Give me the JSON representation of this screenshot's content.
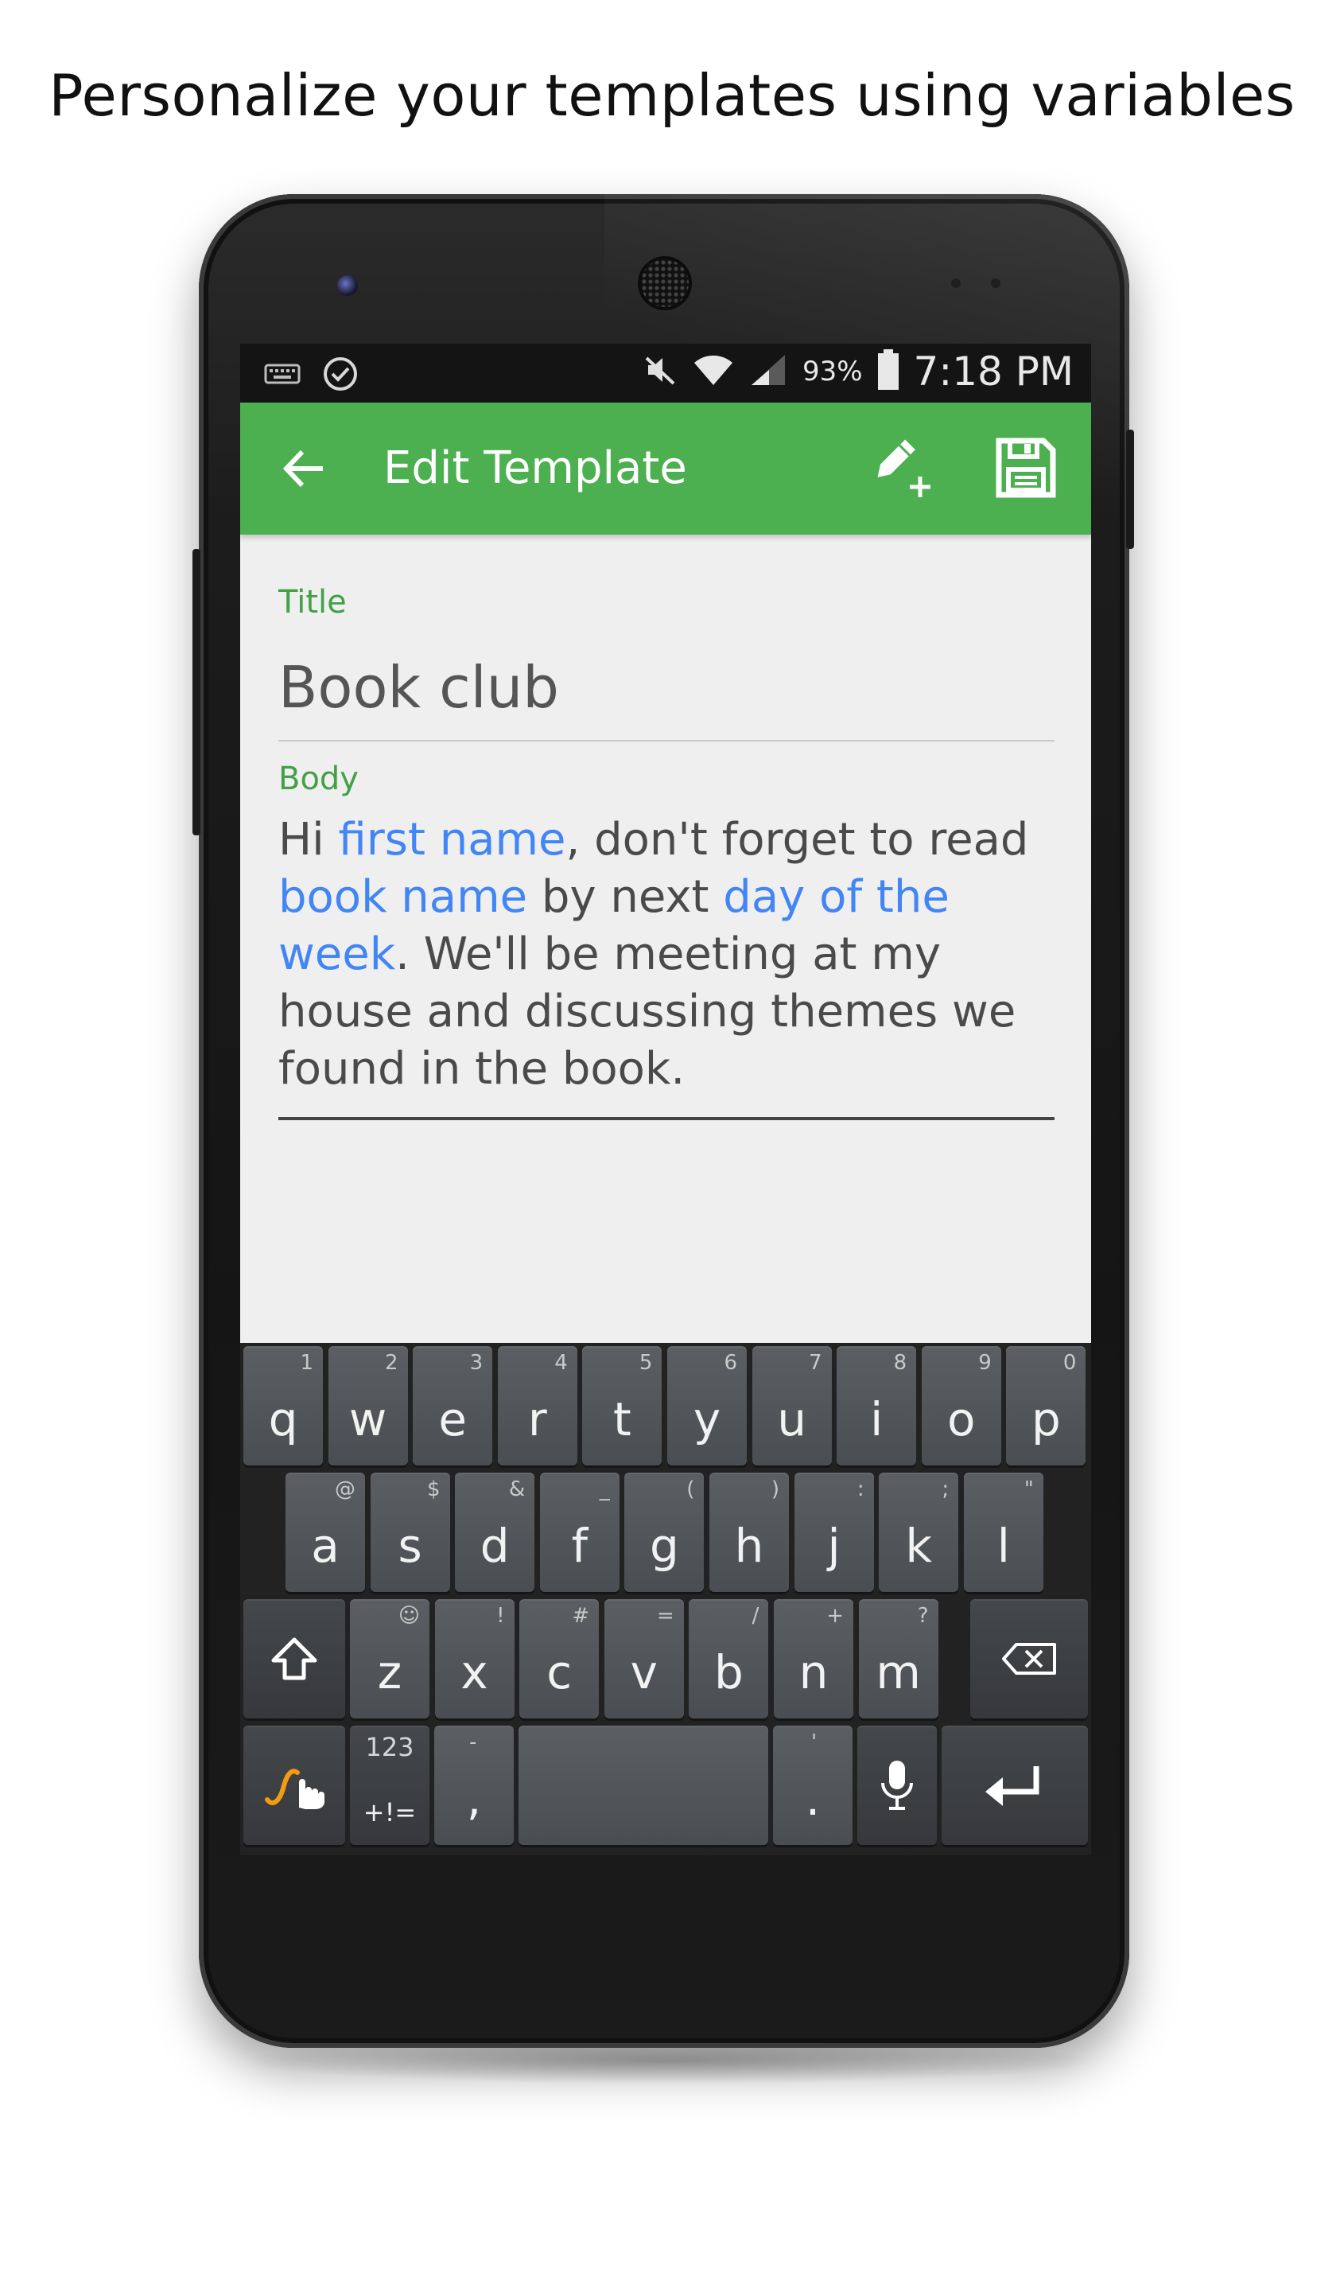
{
  "headline": "Personalize your templates using variables",
  "status_bar": {
    "icons_left": [
      "keyboard-icon",
      "check-circle-icon"
    ],
    "icons_right": [
      "muted-icon",
      "wifi-icon",
      "signal-icon",
      "battery-icon"
    ],
    "battery_percent": "93%",
    "time": "7:18 PM"
  },
  "toolbar": {
    "title": "Edit Template",
    "back_icon": "arrow-back-icon",
    "actions": [
      "insert-variable-icon",
      "save-icon"
    ],
    "color": "#4caf50"
  },
  "form": {
    "title_label": "Title",
    "title_value": "Book club",
    "body_label": "Body",
    "body_parts": [
      {
        "text": "Hi ",
        "var": false
      },
      {
        "text": "first name",
        "var": true
      },
      {
        "text": ", don't forget to read ",
        "var": false
      },
      {
        "text": "book name",
        "var": true
      },
      {
        "text": " by next ",
        "var": false
      },
      {
        "text": "day of the week",
        "var": true
      },
      {
        "text": ". We'll be meeting at my house and discussing themes we found in the book.",
        "var": false
      }
    ],
    "label_color": "#43a047",
    "variable_color": "#4285f4"
  },
  "keyboard": {
    "row1": [
      {
        "k": "q",
        "h": "1"
      },
      {
        "k": "w",
        "h": "2"
      },
      {
        "k": "e",
        "h": "3"
      },
      {
        "k": "r",
        "h": "4"
      },
      {
        "k": "t",
        "h": "5"
      },
      {
        "k": "y",
        "h": "6"
      },
      {
        "k": "u",
        "h": "7"
      },
      {
        "k": "i",
        "h": "8"
      },
      {
        "k": "o",
        "h": "9"
      },
      {
        "k": "p",
        "h": "0"
      }
    ],
    "row2": [
      {
        "k": "a",
        "h": "@"
      },
      {
        "k": "s",
        "h": "$"
      },
      {
        "k": "d",
        "h": "&"
      },
      {
        "k": "f",
        "h": "_"
      },
      {
        "k": "g",
        "h": "("
      },
      {
        "k": "h",
        "h": ")"
      },
      {
        "k": "j",
        "h": ":"
      },
      {
        "k": "k",
        "h": ";"
      },
      {
        "k": "l",
        "h": "\""
      }
    ],
    "row3": [
      {
        "k": "z",
        "h": "☺"
      },
      {
        "k": "x",
        "h": "!"
      },
      {
        "k": "c",
        "h": "#"
      },
      {
        "k": "v",
        "h": "="
      },
      {
        "k": "b",
        "h": "/"
      },
      {
        "k": "n",
        "h": "+"
      },
      {
        "k": "m",
        "h": "?"
      }
    ],
    "symbols_key_top": "123",
    "symbols_key_bottom": "+!=",
    "comma_key": ",",
    "comma_hint": "-",
    "period_key": ".",
    "period_hint": "'",
    "shift_icon": "shift-icon",
    "backspace_icon": "backspace-icon",
    "swype_icon": "swype-icon",
    "mic_icon": "mic-icon",
    "enter_icon": "enter-icon"
  }
}
